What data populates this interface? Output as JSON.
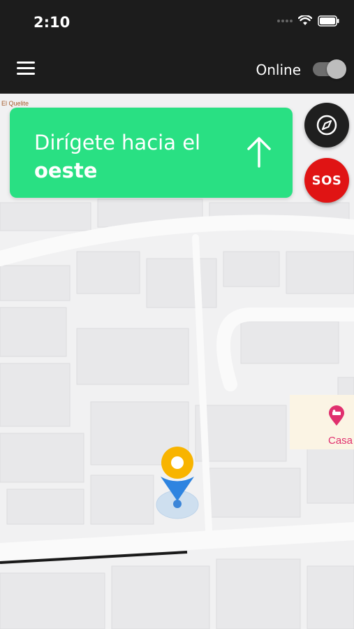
{
  "status_bar": {
    "time": "2:10"
  },
  "app_bar": {
    "menu_icon": "hamburger-menu-icon",
    "status_label": "Online",
    "online_toggle_on": true
  },
  "navigation": {
    "instruction_prefix": "Dirígete hacia el",
    "direction": "oeste",
    "arrow_icon": "arrow-up-icon",
    "card_color": "#29e083"
  },
  "actions": {
    "compass_icon": "compass-icon",
    "sos_label": "SOS",
    "sos_color": "#e01414"
  },
  "map": {
    "place_label": "El Quelite",
    "poi_label": "Casa",
    "poi_icon": "hotel-pin-icon",
    "poi_color": "#e0306e",
    "marker_icon": "location-marker-icon"
  }
}
